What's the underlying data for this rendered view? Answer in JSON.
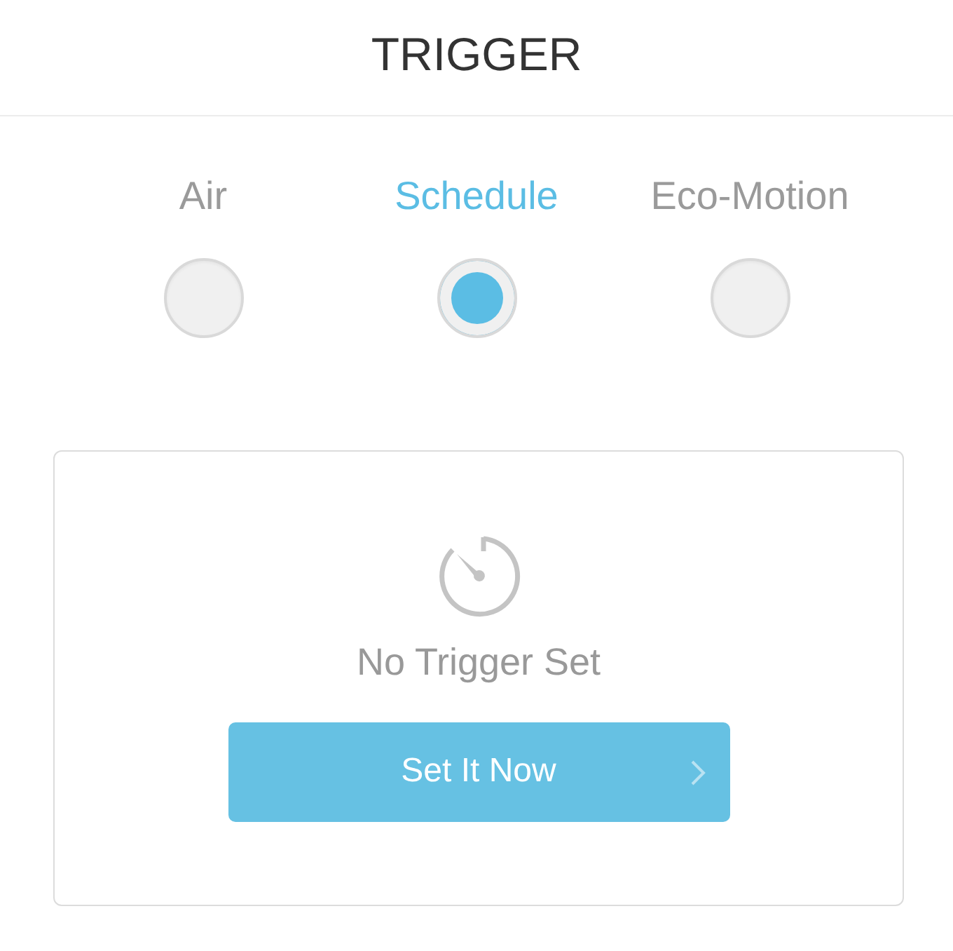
{
  "header": {
    "title": "TRIGGER"
  },
  "options": [
    {
      "label": "Air",
      "selected": false
    },
    {
      "label": "Schedule",
      "selected": true
    },
    {
      "label": "Eco-Motion",
      "selected": false
    }
  ],
  "card": {
    "message": "No Trigger Set",
    "button": "Set It Now"
  }
}
